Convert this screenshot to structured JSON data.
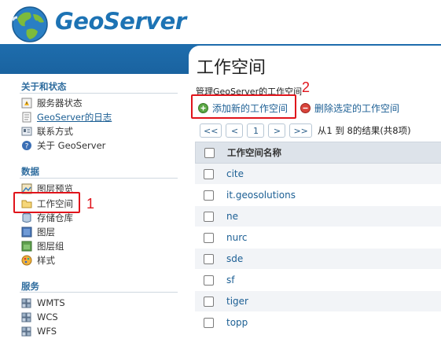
{
  "app": {
    "brand": "GeoServer",
    "accent": "#1d73b4",
    "band_color": "#1e6dad",
    "highlight_color": "#e0141b"
  },
  "sidebar": {
    "sections": [
      {
        "title": "关于和状态",
        "items": [
          {
            "label": "服务器状态",
            "icon": "server-status-icon",
            "link": false
          },
          {
            "label": "GeoServer的日志",
            "icon": "logs-icon",
            "link": true
          },
          {
            "label": "联系方式",
            "icon": "contact-icon",
            "link": false
          },
          {
            "label": "关于 GeoServer",
            "icon": "about-icon",
            "link": false
          }
        ]
      },
      {
        "title": "数据",
        "items": [
          {
            "label": "图层预览",
            "icon": "layer-preview-icon",
            "link": false
          },
          {
            "label": "工作空间",
            "icon": "workspace-folder-icon",
            "link": false
          },
          {
            "label": "存储仓库",
            "icon": "store-icon",
            "link": false
          },
          {
            "label": "图层",
            "icon": "layers-icon",
            "link": false
          },
          {
            "label": "图层组",
            "icon": "layer-group-icon",
            "link": false
          },
          {
            "label": "样式",
            "icon": "styles-icon",
            "link": false
          }
        ]
      },
      {
        "title": "服务",
        "items": [
          {
            "label": "WMTS",
            "icon": "wmts-icon",
            "link": false
          },
          {
            "label": "WCS",
            "icon": "wcs-icon",
            "link": false
          },
          {
            "label": "WFS",
            "icon": "wfs-icon",
            "link": false
          }
        ]
      }
    ]
  },
  "main": {
    "title": "工作空间",
    "description": "管理GeoServer的工作空间",
    "add_label": "添加新的工作空间",
    "remove_label": "删除选定的工作空间",
    "pager": {
      "first": "<<",
      "prev": "<",
      "page": "1",
      "next": ">",
      "last": ">>",
      "info": "从1 到 8的结果(共8项)"
    },
    "table": {
      "header": "工作空间名称",
      "rows": [
        "cite",
        "it.geosolutions",
        "ne",
        "nurc",
        "sde",
        "sf",
        "tiger",
        "topp"
      ]
    }
  },
  "annotations": {
    "marker1": "1",
    "marker2": "2"
  }
}
